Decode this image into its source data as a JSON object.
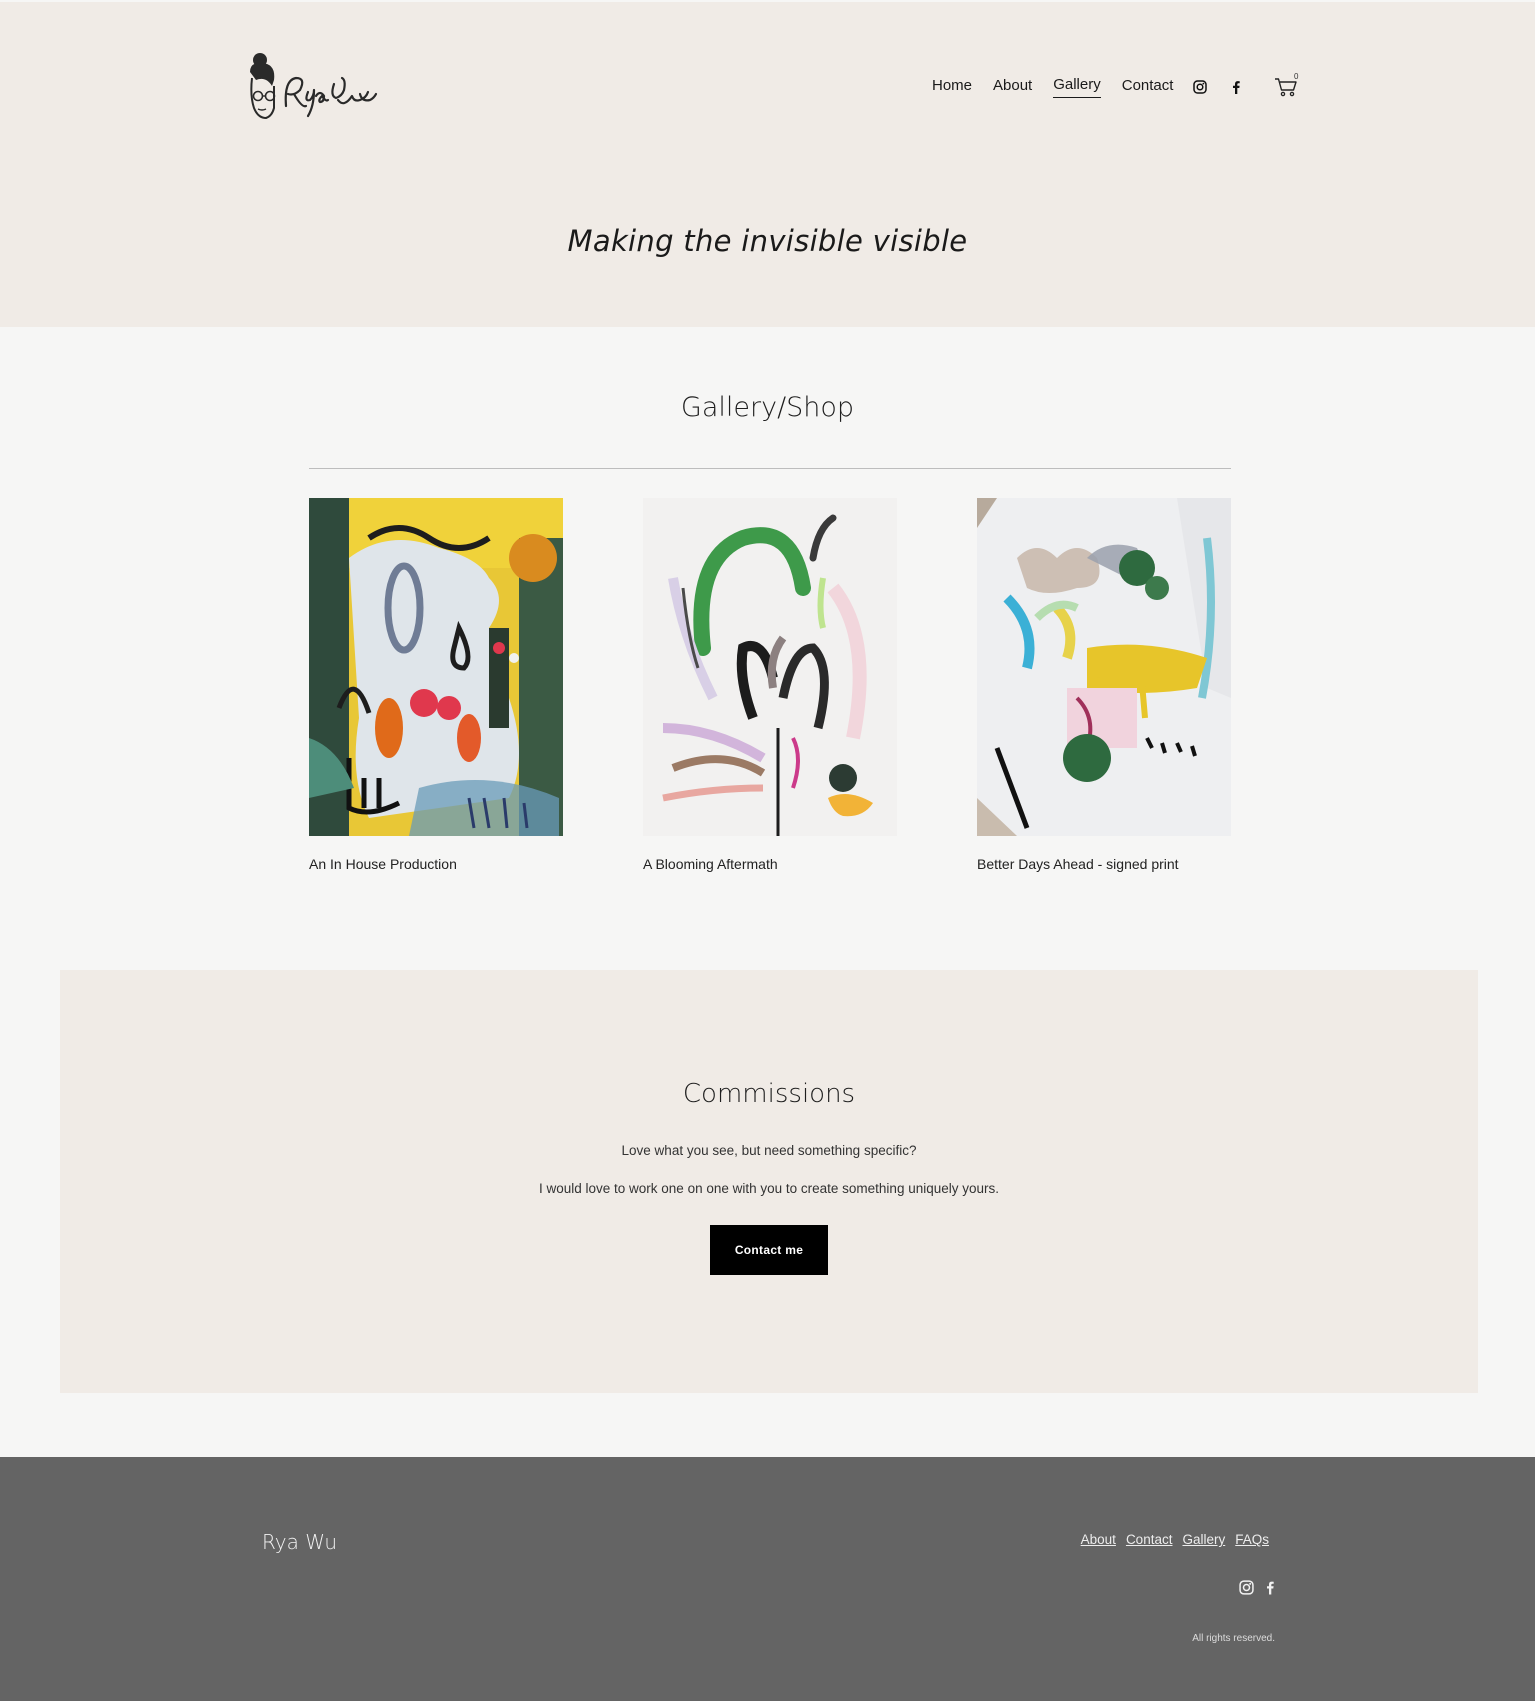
{
  "brand": {
    "logo_alt": "Rya Wu",
    "name": "Rya Wu"
  },
  "nav": {
    "items": [
      {
        "label": "Home",
        "active": false
      },
      {
        "label": "About",
        "active": false
      },
      {
        "label": "Gallery",
        "active": true
      },
      {
        "label": "Contact",
        "active": false
      }
    ],
    "social": [
      "instagram-icon",
      "facebook-icon"
    ],
    "cart_count": "0"
  },
  "hero": {
    "tagline": "Making the invisible visible"
  },
  "gallery": {
    "title": "Gallery/Shop",
    "items": [
      {
        "title": "An In House Production"
      },
      {
        "title": "A Blooming Aftermath"
      },
      {
        "title": "Better Days Ahead - signed print"
      }
    ]
  },
  "commissions": {
    "title": "Commissions",
    "line1": "Love what you see, but need something specific?",
    "line2": "I would love to work one on one with you to create something uniquely yours.",
    "button_label": "Contact me"
  },
  "footer": {
    "brand": "Rya Wu",
    "links": [
      "About",
      "Contact",
      "Gallery",
      "FAQs"
    ],
    "rights": "All rights reserved."
  },
  "colors": {
    "header_bg": "#f0ebe6",
    "page_bg": "#f6f6f5",
    "footer_bg": "#646464",
    "button_bg": "#000000"
  }
}
